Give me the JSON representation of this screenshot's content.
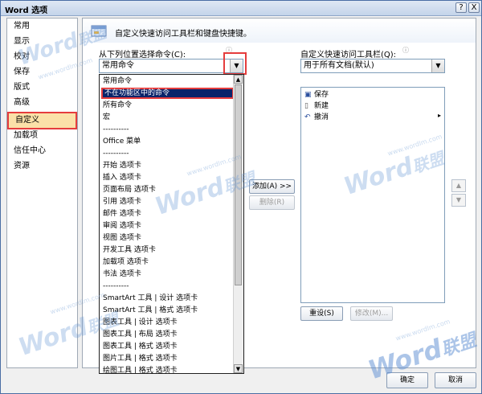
{
  "window": {
    "title": "Word 选项",
    "help_label": "?",
    "close_label": "X"
  },
  "sidebar": {
    "items": [
      {
        "label": "常用"
      },
      {
        "label": "显示"
      },
      {
        "label": "校对"
      },
      {
        "label": "保存"
      },
      {
        "label": "版式"
      },
      {
        "label": "高级"
      },
      {
        "label": "自定义"
      },
      {
        "label": "加载项"
      },
      {
        "label": "信任中心"
      },
      {
        "label": "资源"
      }
    ],
    "selected": "自定义"
  },
  "main": {
    "header_text": "自定义快速访问工具栏和键盘快捷键。",
    "choose_from_label": "从下列位置选择命令(C):",
    "choose_from_value": "常用命令",
    "customize_label": "自定义快速访问工具栏(Q):",
    "customize_value": "用于所有文档(默认)",
    "dropdown_items": [
      "常用命令",
      "不在功能区中的命令",
      "所有命令",
      "宏",
      "----------",
      "Office 菜单",
      "----------",
      "开始 选项卡",
      "插入 选项卡",
      "页面布局 选项卡",
      "引用 选项卡",
      "邮件 选项卡",
      "审阅 选项卡",
      "视图 选项卡",
      "开发工具 选项卡",
      "加载项 选项卡",
      "书法 选项卡",
      "----------",
      "SmartArt 工具 | 设计 选项卡",
      "SmartArt 工具 | 格式 选项卡",
      "图表工具 | 设计 选项卡",
      "图表工具 | 布局 选项卡",
      "图表工具 | 格式 选项卡",
      "图片工具 | 格式 选项卡",
      "绘图工具 | 格式 选项卡"
    ],
    "highlighted_item": "不在功能区中的命令",
    "add_button": "添加(A) >>",
    "remove_button": "删除(R)",
    "toolbar_items": [
      {
        "label": "保存",
        "icon": "save-icon"
      },
      {
        "label": "新建",
        "icon": "new-document-icon"
      },
      {
        "label": "撤消",
        "icon": "undo-icon"
      }
    ],
    "reset_button": "重设(S)",
    "modify_button": "修改(M)..."
  },
  "footer": {
    "ok_button": "确定",
    "cancel_button": "取消"
  },
  "watermark": {
    "text_word": "Word",
    "text_cn": "联盟",
    "url": "www.wordlm.com"
  },
  "colors": {
    "highlight": "#0a246a",
    "annotation_red": "#e53d3d",
    "selected_bg": "#fbe1a8"
  }
}
